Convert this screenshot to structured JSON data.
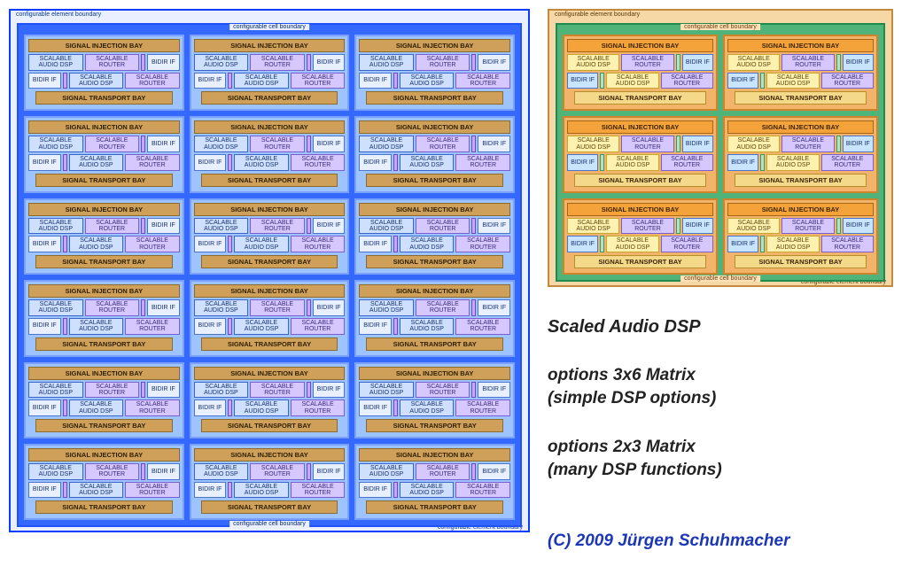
{
  "labels": {
    "elem_boundary": "configurable element boundary",
    "cell_boundary": "configurable cell boundary",
    "injection_bay": "SIGNAL INJECTION BAY",
    "transport_bay": "SIGNAL TRANSPORT BAY",
    "dsp": "SCALABLE AUDIO DSP",
    "router": "SCALABLE ROUTER",
    "bidir": "BIDIR IF"
  },
  "left_matrix": {
    "rows": 6,
    "cols": 3,
    "theme": "blue"
  },
  "right_matrix": {
    "rows": 3,
    "cols": 2,
    "theme": "warm"
  },
  "title": "Scaled Audio DSP",
  "option1": {
    "line1": "options 3x6 Matrix",
    "line2": "(simple DSP options)"
  },
  "option2": {
    "line1": "options 2x3 Matrix",
    "line2": "(many DSP functions)"
  },
  "copyright": "(C) 2009 Jürgen Schuhmacher"
}
